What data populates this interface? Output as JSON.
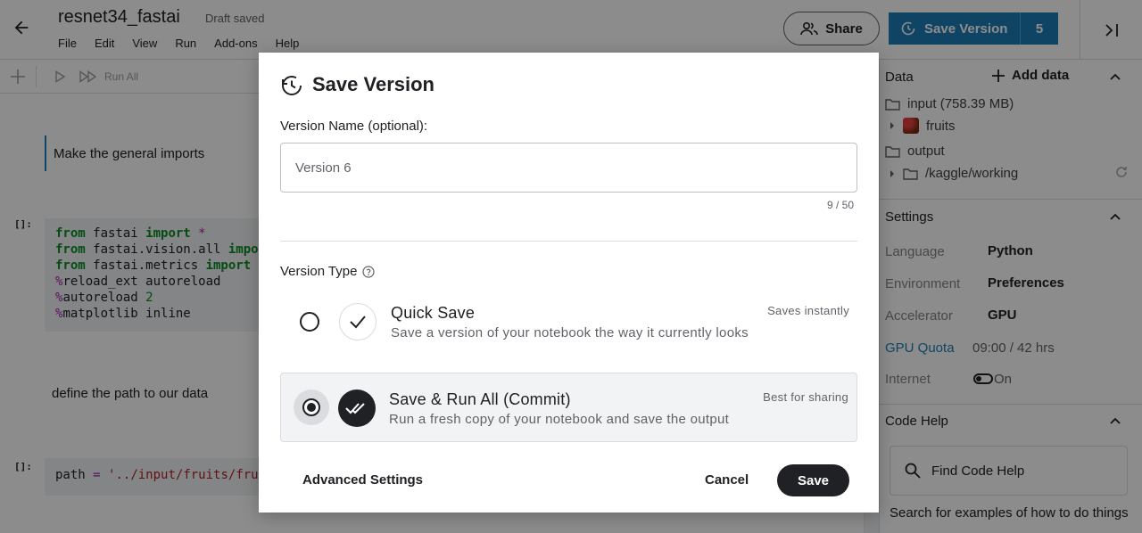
{
  "header": {
    "notebook_title": "resnet34_fastai",
    "draft_status": "Draft saved",
    "menu": [
      "File",
      "Edit",
      "View",
      "Run",
      "Add-ons",
      "Help"
    ],
    "share_label": "Share",
    "save_version_label": "Save Version",
    "version_count": "5"
  },
  "toolbar": {
    "run_all_label": "Run All"
  },
  "notebook": {
    "md_cell_1": "Make the general imports",
    "prompt_1": "[]:",
    "code_1": [
      {
        "parts": [
          [
            "kw",
            "from"
          ],
          [
            "t",
            " fastai "
          ],
          [
            "kw",
            "import"
          ],
          [
            "t",
            " "
          ],
          [
            "mg",
            "*"
          ]
        ]
      },
      {
        "parts": [
          [
            "kw",
            "from"
          ],
          [
            "t",
            " fastai.vision.all "
          ],
          [
            "kw",
            "impo"
          ]
        ]
      },
      {
        "parts": [
          [
            "kw",
            "from"
          ],
          [
            "t",
            " fastai.metrics "
          ],
          [
            "kw",
            "import"
          ]
        ]
      },
      {
        "parts": [
          [
            "mg",
            "%"
          ],
          [
            "t",
            "reload_ext autoreload"
          ]
        ]
      },
      {
        "parts": [
          [
            "mg",
            "%"
          ],
          [
            "t",
            "autoreload "
          ],
          [
            "num",
            "2"
          ]
        ]
      },
      {
        "parts": [
          [
            "mg",
            "%"
          ],
          [
            "t",
            "matplotlib inline"
          ]
        ]
      }
    ],
    "md_cell_2": "define the path to our data",
    "prompt_2": "[]:",
    "code_2": [
      {
        "parts": [
          [
            "t",
            "path "
          ],
          [
            "mg",
            "="
          ],
          [
            "t",
            " "
          ],
          [
            "str",
            "'../input/fruits/fru"
          ]
        ]
      }
    ]
  },
  "sidebar": {
    "data_heading": "Data",
    "add_data_label": "Add data",
    "input_label": "input (758.39 MB)",
    "fruits_label": "fruits",
    "output_label": "output",
    "working_label": "/kaggle/working",
    "settings_heading": "Settings",
    "settings": {
      "language_label": "Language",
      "language_value": "Python",
      "environment_label": "Environment",
      "environment_value": "Preferences",
      "accelerator_label": "Accelerator",
      "accelerator_value": "GPU",
      "gpu_quota_label": "GPU Quota",
      "gpu_quota_value": "09:00 / 42 hrs",
      "internet_label": "Internet",
      "internet_value": "On"
    },
    "code_help_heading": "Code Help",
    "find_help_label": "Find Code Help",
    "help_description": "Search for examples of how to do things"
  },
  "modal": {
    "title": "Save Version",
    "version_name_label": "Version Name (optional):",
    "version_name_value": "Version 6",
    "char_counter": "9 / 50",
    "version_type_label": "Version Type",
    "options": [
      {
        "title": "Quick Save",
        "description": "Save a version of your notebook the way it currently looks",
        "hint": "Saves instantly",
        "selected": false
      },
      {
        "title": "Save & Run All (Commit)",
        "description": "Run a fresh copy of your notebook and save the output",
        "hint": "Best for sharing",
        "selected": true
      }
    ],
    "advanced_settings_label": "Advanced Settings",
    "cancel_label": "Cancel",
    "save_label": "Save"
  },
  "colors": {
    "accent": "#1c7db8",
    "dark": "#202124",
    "overlay": "rgba(0,0,0,0.45)"
  }
}
